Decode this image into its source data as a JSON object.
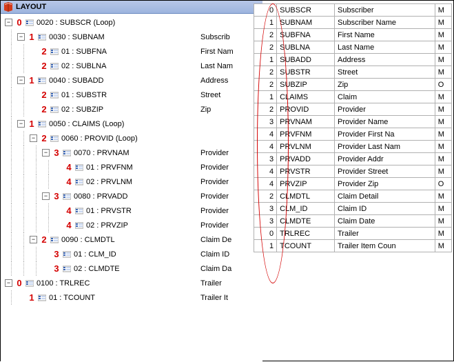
{
  "header": {
    "title": "LAYOUT"
  },
  "tree": [
    {
      "indent": 0,
      "exp": "−",
      "depth": "0",
      "code": "0020 : SUBSCR (Loop)",
      "desc": ""
    },
    {
      "indent": 1,
      "exp": "−",
      "depth": "1",
      "code": "0030 : SUBNAM",
      "desc": "Subscrib"
    },
    {
      "indent": 2,
      "exp": "",
      "depth": "2",
      "code": "01 : SUBFNA",
      "desc": "First Nam"
    },
    {
      "indent": 2,
      "exp": "",
      "depth": "2",
      "code": "02 : SUBLNA",
      "desc": "Last Nam"
    },
    {
      "indent": 1,
      "exp": "−",
      "depth": "1",
      "code": "0040 : SUBADD",
      "desc": "Address"
    },
    {
      "indent": 2,
      "exp": "",
      "depth": "2",
      "code": "01 : SUBSTR",
      "desc": "Street"
    },
    {
      "indent": 2,
      "exp": "",
      "depth": "2",
      "code": "02 : SUBZIP",
      "desc": "Zip"
    },
    {
      "indent": 1,
      "exp": "−",
      "depth": "1",
      "code": "0050 : CLAIMS (Loop)",
      "desc": ""
    },
    {
      "indent": 2,
      "exp": "−",
      "depth": "2",
      "code": "0060 : PROVID (Loop)",
      "desc": ""
    },
    {
      "indent": 3,
      "exp": "−",
      "depth": "3",
      "code": "0070 : PRVNAM",
      "desc": "Provider"
    },
    {
      "indent": 4,
      "exp": "",
      "depth": "4",
      "code": "01 : PRVFNM",
      "desc": "Provider"
    },
    {
      "indent": 4,
      "exp": "",
      "depth": "4",
      "code": "02 : PRVLNM",
      "desc": "Provider"
    },
    {
      "indent": 3,
      "exp": "−",
      "depth": "3",
      "code": "0080 : PRVADD",
      "desc": "Provider"
    },
    {
      "indent": 4,
      "exp": "",
      "depth": "4",
      "code": "01 : PRVSTR",
      "desc": "Provider"
    },
    {
      "indent": 4,
      "exp": "",
      "depth": "4",
      "code": "02 : PRVZIP",
      "desc": "Provider"
    },
    {
      "indent": 2,
      "exp": "−",
      "depth": "2",
      "code": "0090 : CLMDTL",
      "desc": "Claim De"
    },
    {
      "indent": 3,
      "exp": "",
      "depth": "3",
      "code": "01 : CLM_ID",
      "desc": "Claim ID"
    },
    {
      "indent": 3,
      "exp": "",
      "depth": "3",
      "code": "02 : CLMDTE",
      "desc": "Claim Da"
    },
    {
      "indent": 0,
      "exp": "−",
      "depth": "0",
      "code": "0100 : TRLREC",
      "desc": "Trailer"
    },
    {
      "indent": 1,
      "exp": "",
      "depth": "1",
      "code": "01 : TCOUNT",
      "desc": "Trailer It"
    }
  ],
  "table": [
    {
      "d": "0",
      "c": "SUBSCR",
      "l": "Subscriber",
      "m": "M"
    },
    {
      "d": "1",
      "c": "SUBNAM",
      "l": "Subscriber Name",
      "m": "M"
    },
    {
      "d": "2",
      "c": "SUBFNA",
      "l": "First Name",
      "m": "M"
    },
    {
      "d": "2",
      "c": "SUBLNA",
      "l": "Last Name",
      "m": "M"
    },
    {
      "d": "1",
      "c": "SUBADD",
      "l": "Address",
      "m": "M"
    },
    {
      "d": "2",
      "c": "SUBSTR",
      "l": "Street",
      "m": "M"
    },
    {
      "d": "2",
      "c": "SUBZIP",
      "l": "Zip",
      "m": "O"
    },
    {
      "d": "1",
      "c": "CLAIMS",
      "l": "Claim",
      "m": "M"
    },
    {
      "d": "2",
      "c": "PROVID",
      "l": "Provider",
      "m": "M"
    },
    {
      "d": "3",
      "c": "PRVNAM",
      "l": "Provider Name",
      "m": "M"
    },
    {
      "d": "4",
      "c": "PRVFNM",
      "l": "Provider First Na",
      "m": "M"
    },
    {
      "d": "4",
      "c": "PRVLNM",
      "l": "Provider Last Nam",
      "m": "M"
    },
    {
      "d": "3",
      "c": "PRVADD",
      "l": "Provider Addr",
      "m": "M"
    },
    {
      "d": "4",
      "c": "PRVSTR",
      "l": "Provider Street",
      "m": "M"
    },
    {
      "d": "4",
      "c": "PRVZIP",
      "l": "Provider Zip",
      "m": "O"
    },
    {
      "d": "2",
      "c": "CLMDTL",
      "l": "Claim Detail",
      "m": "M"
    },
    {
      "d": "3",
      "c": "CLM_ID",
      "l": "Claim ID",
      "m": "M"
    },
    {
      "d": "3",
      "c": "CLMDTE",
      "l": "Claim Date",
      "m": "M"
    },
    {
      "d": "0",
      "c": "TRLREC",
      "l": "Trailer",
      "m": "M"
    },
    {
      "d": "1",
      "c": "TCOUNT",
      "l": "Trailer Item Coun",
      "m": "M"
    }
  ]
}
